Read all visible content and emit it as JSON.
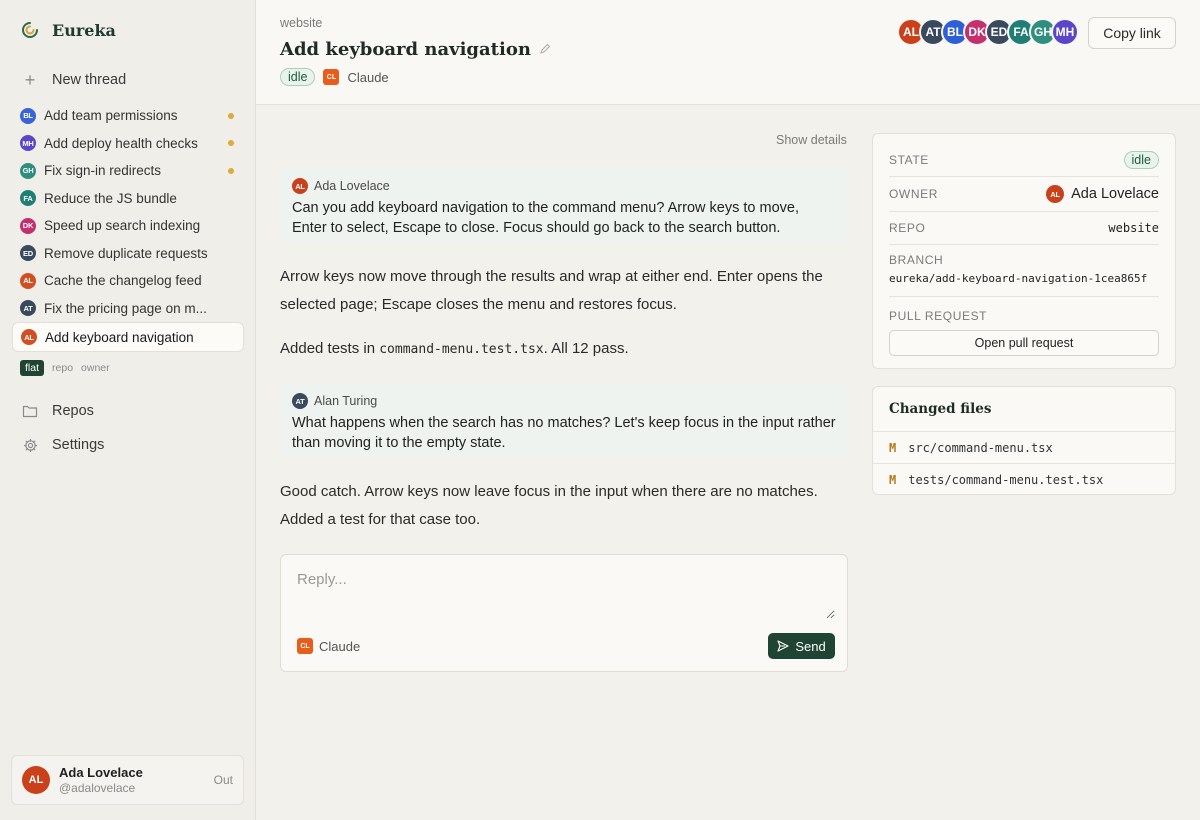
{
  "brand": {
    "name": "Eureka"
  },
  "sidebar": {
    "new_thread": "New thread",
    "threads": [
      {
        "initials": "BL",
        "label": "Add team permissions",
        "color": "#3b63d6",
        "unread": true
      },
      {
        "initials": "MH",
        "label": "Add deploy health checks",
        "color": "#5b46c9",
        "unread": true
      },
      {
        "initials": "GH",
        "label": "Fix sign-in redirects",
        "color": "#2f8f7f",
        "unread": true
      },
      {
        "initials": "FA",
        "label": "Reduce the JS bundle",
        "color": "#1f7f76",
        "unread": false
      },
      {
        "initials": "DK",
        "label": "Speed up search indexing",
        "color": "#c4306e",
        "unread": false
      },
      {
        "initials": "ED",
        "label": "Remove duplicate requests",
        "color": "#3a4a5e",
        "unread": false
      },
      {
        "initials": "AL",
        "label": "Cache the changelog feed",
        "color": "#d24f24",
        "unread": false
      },
      {
        "initials": "AT",
        "label": "Fix the pricing page on m...",
        "color": "#3a4a5e",
        "unread": false
      },
      {
        "initials": "AL",
        "label": "Add keyboard navigation",
        "color": "#d24f24",
        "unread": false,
        "active": true
      }
    ],
    "filter": {
      "flat": "flat",
      "repo": "repo",
      "owner": "owner"
    },
    "repos": "Repos",
    "settings": "Settings",
    "user": {
      "initials": "AL",
      "name": "Ada Lovelace",
      "handle": "@adalovelace",
      "out": "Out"
    }
  },
  "header": {
    "crumb": "website",
    "title": "Add keyboard navigation",
    "status": "idle",
    "agent_badge": "CL",
    "agent": "Claude",
    "participants": [
      {
        "initials": "AL",
        "color": "#c9401a"
      },
      {
        "initials": "AT",
        "color": "#3a4a5e"
      },
      {
        "initials": "BL",
        "color": "#2f5fd6"
      },
      {
        "initials": "DK",
        "color": "#c4306e"
      },
      {
        "initials": "ED",
        "color": "#3a4a5e"
      },
      {
        "initials": "FA",
        "color": "#1f7f76"
      },
      {
        "initials": "GH",
        "color": "#2f8f7f"
      },
      {
        "initials": "MH",
        "color": "#5b46c9"
      }
    ],
    "copy_link": "Copy link"
  },
  "conversation": {
    "show_details": "Show details",
    "msg1": {
      "initials": "AL",
      "author": "Ada Lovelace",
      "text": "Can you add keyboard navigation to the command menu? Arrow keys to move, Enter to select, Escape to close. Focus should go back to the search button."
    },
    "reply1": "Arrow keys now move through the results and wrap at either end. Enter opens the selected page; Escape closes the menu and restores focus.",
    "reply2_pre": "Added tests in ",
    "reply2_code": "command-menu.test.tsx",
    "reply2_post": ". All 12 pass.",
    "msg2": {
      "initials": "AT",
      "author": "Alan Turing",
      "text": "What happens when the search has no matches? Let's keep focus in the input rather than moving it to the empty state."
    },
    "reply3": "Good catch. Arrow keys now leave focus in the input when there are no matches. Added a test for that case too."
  },
  "composer": {
    "placeholder": "Reply...",
    "agent_badge": "CL",
    "agent": "Claude",
    "send": "Send"
  },
  "details": {
    "state_label": "STATE",
    "state_value": "idle",
    "owner_label": "OWNER",
    "owner_initials": "AL",
    "owner_value": "Ada Lovelace",
    "repo_label": "REPO",
    "repo_value": "website",
    "branch_label": "BRANCH",
    "branch_value": "eureka/add-keyboard-navigation-1cea865f",
    "pr_label": "PULL REQUEST",
    "pr_button": "Open pull request"
  },
  "files": {
    "title": "Changed files",
    "items": [
      {
        "status": "M",
        "path": "src/command-menu.tsx"
      },
      {
        "status": "M",
        "path": "tests/command-menu.test.tsx"
      }
    ]
  }
}
